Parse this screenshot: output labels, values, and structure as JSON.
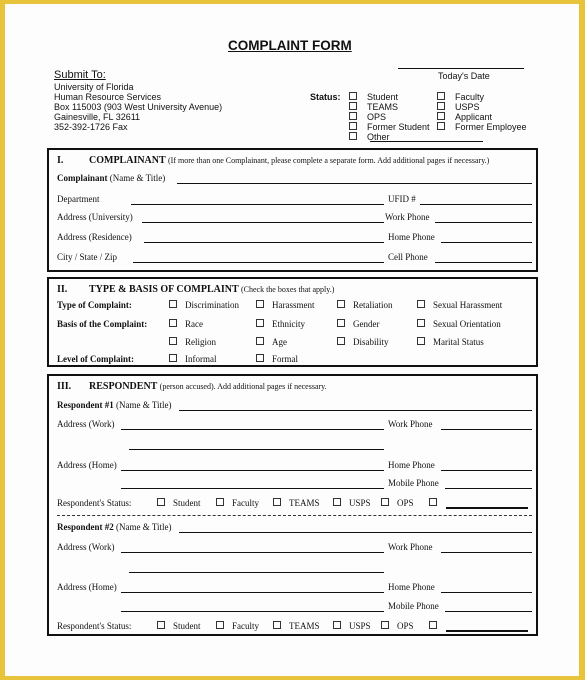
{
  "title": "COMPLAINT FORM",
  "submit_to": {
    "heading": "Submit To:",
    "lines": [
      "University of Florida",
      "Human Resource Services",
      "Box 115003 (903 West University Avenue)",
      "Gainesville, FL  32611",
      "352-392-1726 Fax"
    ]
  },
  "date_label": "Today's Date",
  "status": {
    "label": "Status:",
    "left": [
      "Student",
      "TEAMS",
      "OPS",
      "Former Student",
      "Other"
    ],
    "right": [
      "Faculty",
      "USPS",
      "Applicant",
      "Former Employee"
    ]
  },
  "section1": {
    "num": "I.",
    "title": "COMPLAINANT",
    "note": "(If more than one Complainant, please complete a separate form.  Add additional pages if necessary.)",
    "complainant_bold": "Complainant",
    "complainant_rest": "(Name & Title)",
    "department": "Department",
    "ufid": "UFID #",
    "addr_univ": "Address (University)",
    "work_phone": "Work Phone",
    "addr_res": "Address (Residence)",
    "home_phone": "Home Phone",
    "city": "City / State / Zip",
    "cell_phone": "Cell Phone"
  },
  "section2": {
    "num": "II.",
    "title": "TYPE & BASIS OF COMPLAINT",
    "note": "(Check the boxes that apply.)",
    "type_label": "Type of Complaint:",
    "types": [
      "Discrimination",
      "Harassment",
      "Retaliation",
      "Sexual Harassment"
    ],
    "basis_label": "Basis of the Complaint:",
    "basis_row1": [
      "Race",
      "Ethnicity",
      "Gender",
      "Sexual Orientation"
    ],
    "basis_row2": [
      "Religion",
      "Age",
      "Disability",
      "Marital Status"
    ],
    "level_label": "Level of Complaint:",
    "levels": [
      "Informal",
      "Formal"
    ]
  },
  "section3": {
    "num": "III.",
    "title": "RESPONDENT",
    "note": "(person accused).  Add additional pages if necessary.",
    "respondents": [
      {
        "bold": "Respondent #1",
        "rest": "(Name & Title)"
      },
      {
        "bold": "Respondent #2",
        "rest": "(Name & Title)"
      }
    ],
    "addr_work": "Address (Work)",
    "work_phone": "Work Phone",
    "addr_home": "Address (Home)",
    "home_phone": "Home Phone",
    "mobile_phone": "Mobile Phone",
    "status_label": "Respondent's Status:",
    "status_opts": [
      "Student",
      "Faculty",
      "TEAMS",
      "USPS",
      "OPS"
    ]
  }
}
